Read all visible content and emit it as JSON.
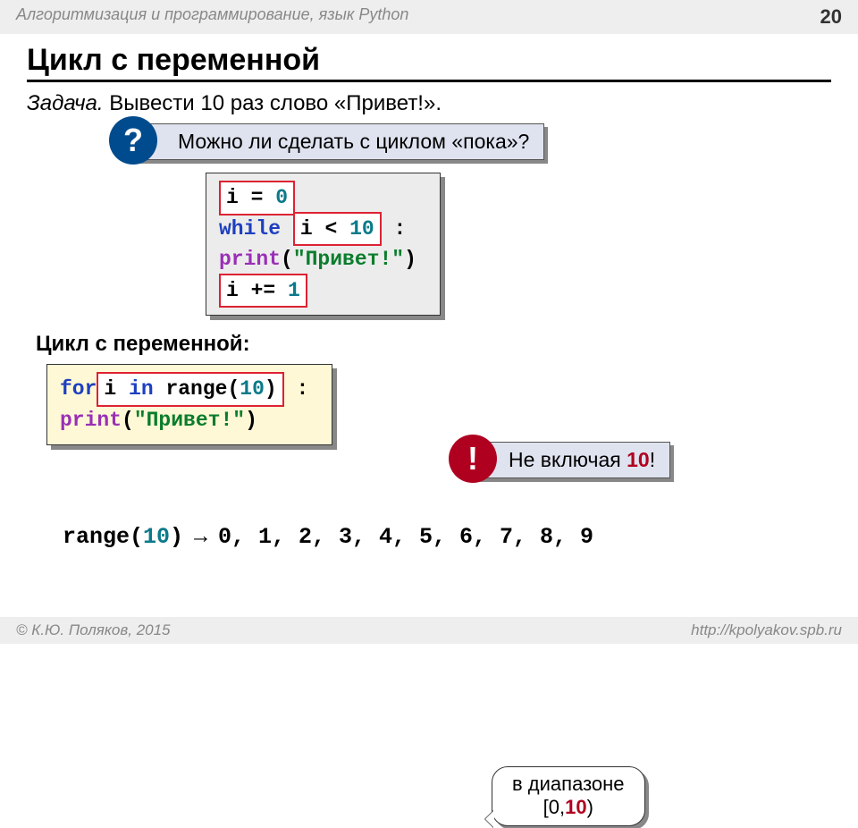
{
  "header": {
    "course": "Алгоритмизация и программирование, язык Python",
    "page": "20"
  },
  "title": "Цикл с переменной",
  "task": {
    "lead": "Задача.",
    "body": " Вывести 10 раз слово «Привет!»."
  },
  "q_callout": {
    "badge": "?",
    "text": "Можно ли сделать с циклом «пока»?"
  },
  "code_while": {
    "l1_a": "i",
    "l1_b": " = ",
    "l1_c": "0",
    "l2_kw": "while",
    "l2_cond_a": "i",
    "l2_cond_b": " < ",
    "l2_cond_c": "10",
    "l2_tail": " :",
    "l3_a": "   ",
    "l3_fn": "print",
    "l3_b": "(",
    "l3_str": "\"Привет!\"",
    "l3_c": ")",
    "l4_a": "   ",
    "l4_b": "i",
    "l4_c": " += ",
    "l4_d": "1"
  },
  "sub": "Цикл с переменной:",
  "code_for": {
    "l1_kw": "for",
    "l1_mid_a": " i ",
    "l1_mid_kw": "in",
    "l1_mid_b": " range(",
    "l1_mid_num": "10",
    "l1_mid_c": ")",
    "l1_tail": " :",
    "l2_a": "   ",
    "l2_fn": "print",
    "l2_b": "(",
    "l2_str": "\"Привет!\"",
    "l2_c": ")"
  },
  "bubble": {
    "line1": "в диапазоне",
    "line2_a": "[0,",
    "line2_b": "10",
    "line2_c": ")"
  },
  "warn_callout": {
    "badge": "!",
    "text_a": "Не включая ",
    "text_b": "10",
    "text_c": "!"
  },
  "rangeline": {
    "a": "range(",
    "num": "10",
    "b": ")",
    "arrow": "  →  ",
    "seq": "0, 1, 2, 3, 4, 5, 6, 7, 8, 9"
  },
  "footer": {
    "left": "© К.Ю. Поляков, 2015",
    "right": "http://kpolyakov.spb.ru"
  }
}
